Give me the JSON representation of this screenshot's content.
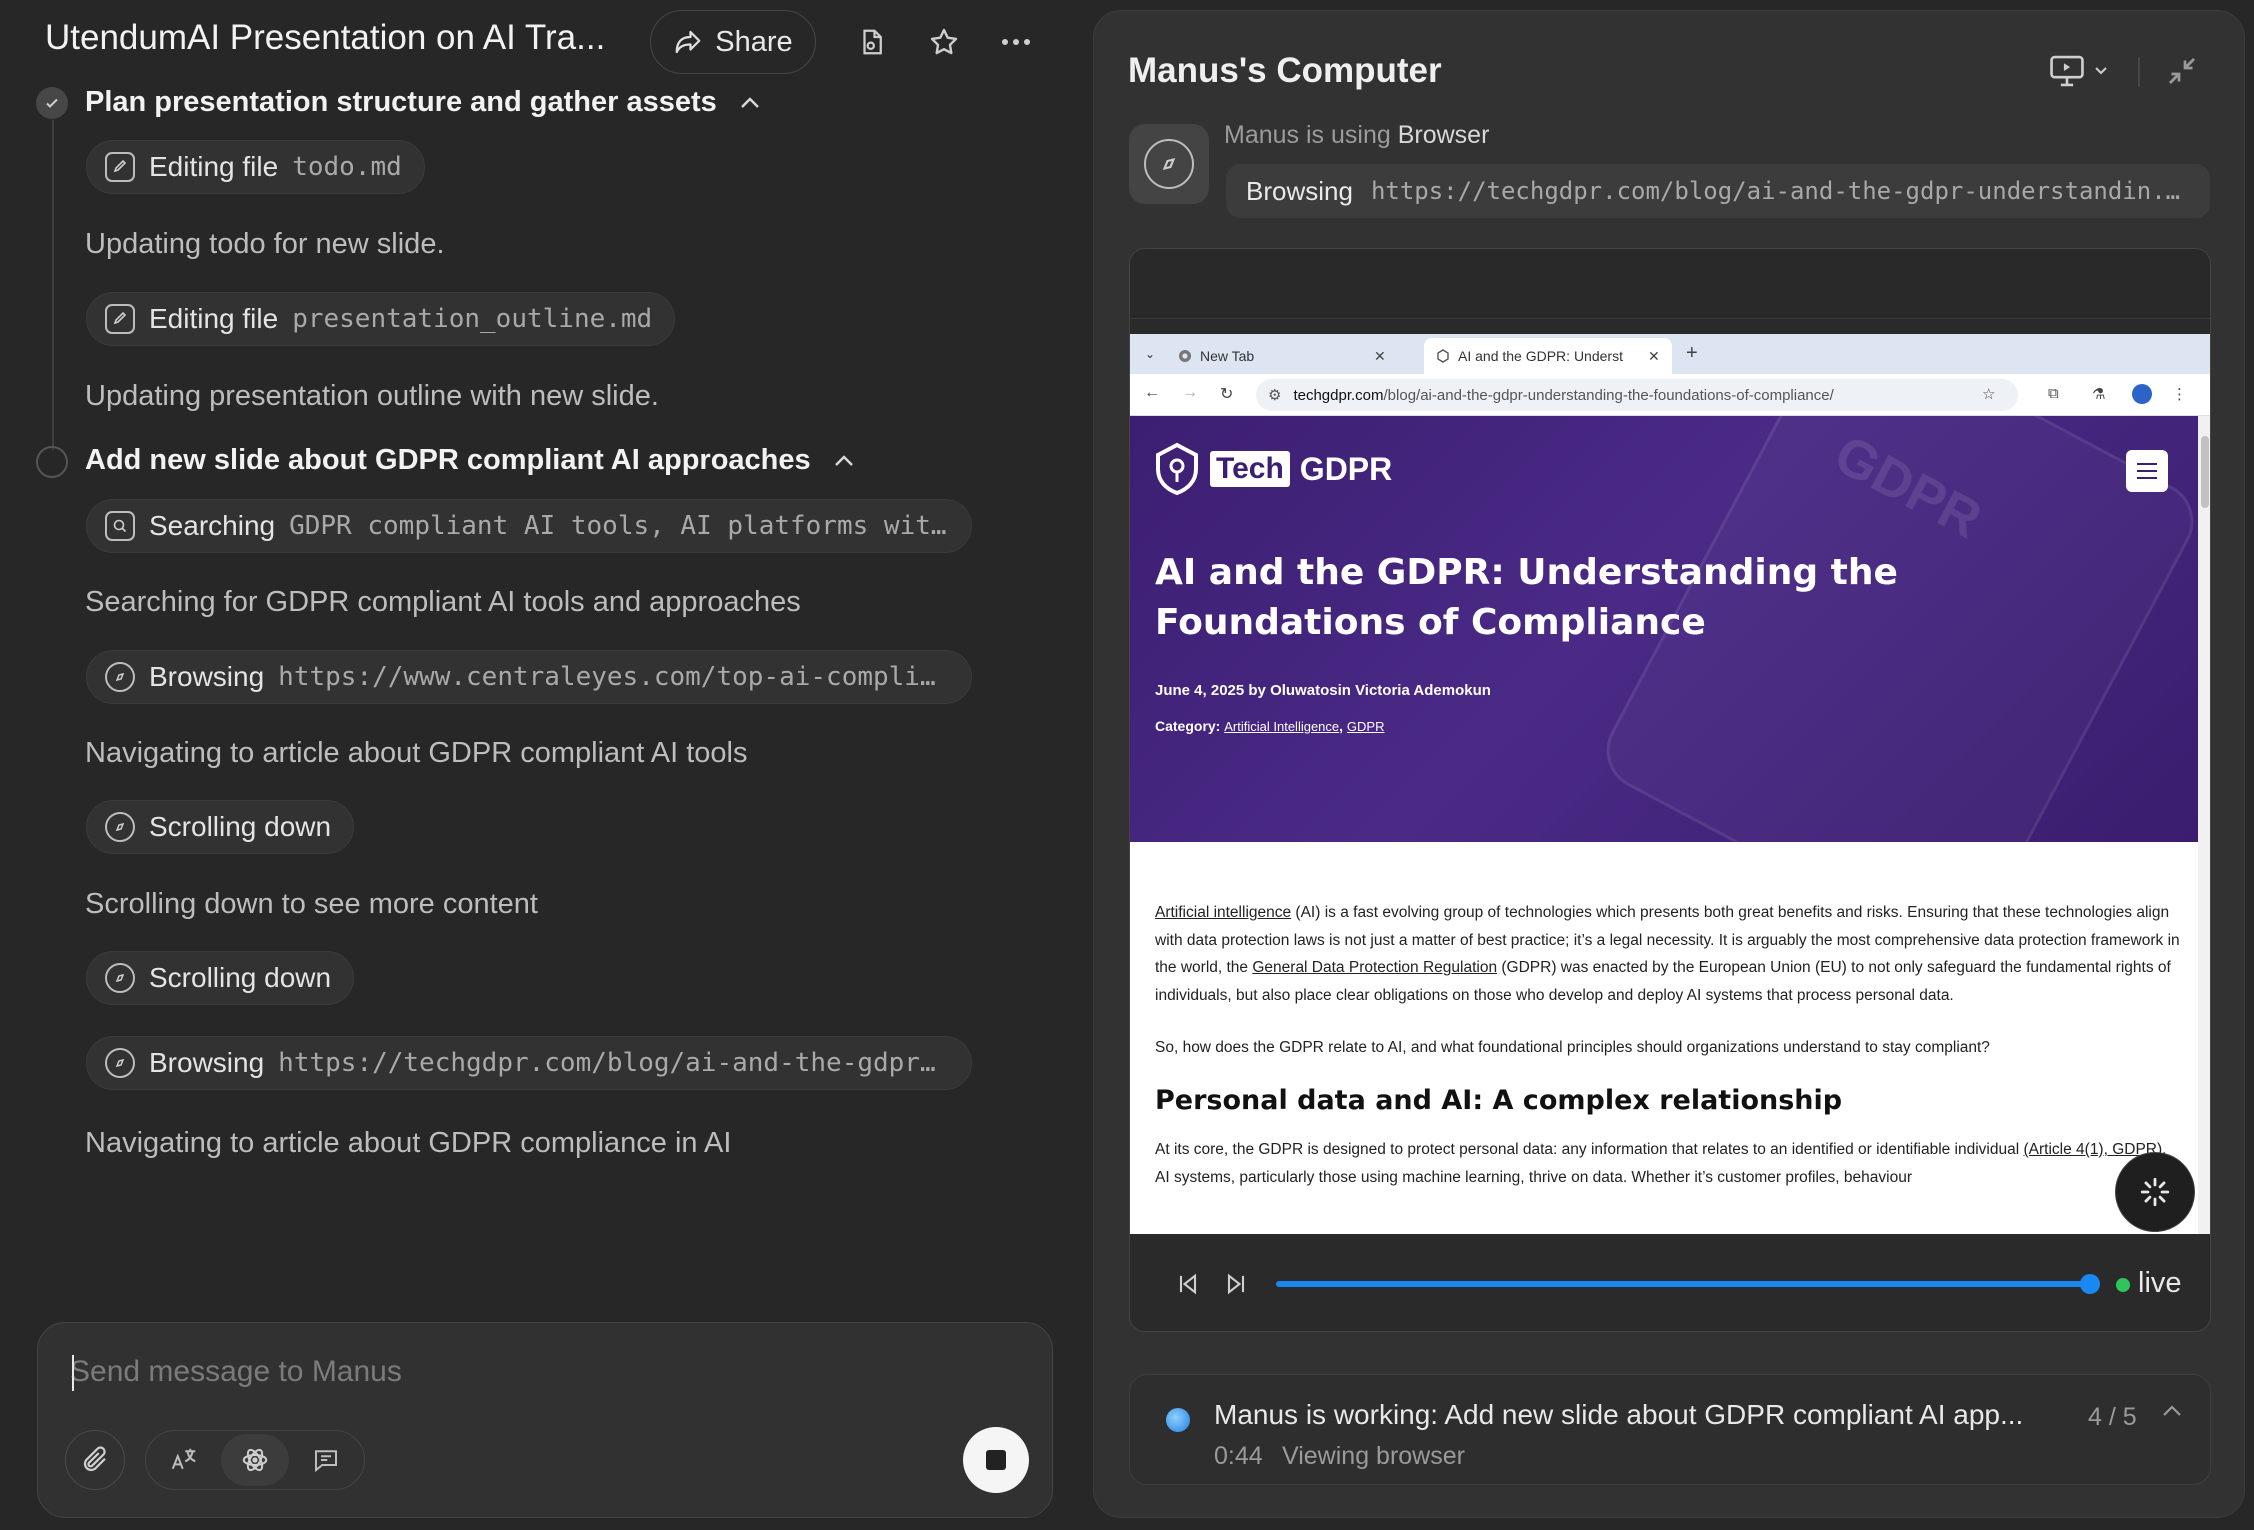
{
  "left": {
    "title": "UtendumAI Presentation on AI Tra...",
    "share_label": "Share",
    "steps": [
      {
        "title": "Plan presentation structure and gather assets",
        "items": [
          {
            "type": "pill",
            "icon": "edit-file-icon",
            "action": "Editing file",
            "arg": "todo.md"
          },
          {
            "type": "note",
            "text": "Updating todo for new slide."
          },
          {
            "type": "pill",
            "icon": "edit-file-icon",
            "action": "Editing file",
            "arg": "presentation_outline.md"
          },
          {
            "type": "note",
            "text": "Updating presentation outline with new slide."
          }
        ]
      },
      {
        "title": "Add new slide about GDPR compliant AI approaches",
        "items": [
          {
            "type": "pill",
            "icon": "search-icon",
            "action": "Searching",
            "arg": "GDPR compliant AI tools, AI platforms with G..."
          },
          {
            "type": "note",
            "text": "Searching for GDPR compliant AI tools and approaches"
          },
          {
            "type": "pill",
            "icon": "compass-icon",
            "action": "Browsing",
            "arg": "https://www.centraleyes.com/top-ai-complianc..."
          },
          {
            "type": "note",
            "text": "Navigating to article about GDPR compliant AI tools"
          },
          {
            "type": "pill",
            "icon": "compass-icon",
            "action": "Scrolling down",
            "arg": ""
          },
          {
            "type": "note",
            "text": "Scrolling down to see more content"
          },
          {
            "type": "pill",
            "icon": "compass-icon",
            "action": "Scrolling down",
            "arg": ""
          },
          {
            "type": "pill",
            "icon": "compass-icon",
            "action": "Browsing",
            "arg": "https://techgdpr.com/blog/ai-and-the-gdpr-un..."
          },
          {
            "type": "note",
            "text": "Navigating to article about GDPR compliance in AI"
          }
        ]
      }
    ],
    "composer": {
      "placeholder": "Send message to Manus"
    }
  },
  "right": {
    "title": "Manus's Computer",
    "using_prefix": "Manus is using",
    "using_tool": "Browser",
    "action": "Browsing",
    "action_url": "https://techgdpr.com/blog/ai-and-the-gdpr-understandin...",
    "browser": {
      "tabs": [
        {
          "label": "New Tab"
        },
        {
          "label": "AI and the GDPR: Underst"
        }
      ],
      "url_host": "techgdpr.com",
      "url_path": "/blog/ai-and-the-gdpr-understanding-the-foundations-of-compliance/",
      "page": {
        "logo_tech": "Tech",
        "logo_gdpr": "GDPR",
        "hero_watermark": "GDPR",
        "headline": "AI and the GDPR: Understanding the Foundations of Compliance",
        "byline": "June 4, 2025 by Oluwatosin Victoria Ademokun",
        "category_label": "Category:",
        "category_1": "Artificial Intelligence",
        "category_sep": ",",
        "category_2": "GDPR",
        "p1_link1": "Artificial intelligence",
        "p1_a": " (AI) is a fast evolving group of technologies which presents both great benefits and risks. Ensuring that these technologies align with data protection laws is not just a matter of best practice; it’s a legal necessity. It is arguably the most comprehensive data protection framework in the world, the ",
        "p1_link2": "General Data Protection Regulation",
        "p1_b": " (GDPR) was enacted by the European Union (EU) to not only safeguard the fundamental rights of individuals, but also place clear obligations on those who develop and deploy AI systems that process personal data.",
        "p2": "So, how does the GDPR relate to AI, and what foundational principles should organizations understand to stay compliant?",
        "h2": "Personal data and AI: A complex relationship",
        "p3_a": "At its core, the GDPR is designed to protect personal data: any information that relates to an identified or identifiable individual ",
        "p3_link": "(Article 4(1), GDPR)",
        "p3_b": ". AI systems, particularly those using machine learning, thrive on data. Whether it’s customer profiles, behaviour"
      }
    },
    "playback": {
      "live_label": "live",
      "progress": 1.0
    },
    "status": {
      "message": "Manus is working: Add new slide about GDPR compliant AI app...",
      "time": "0:44",
      "sub": "Viewing browser",
      "count": "4 / 5"
    }
  }
}
